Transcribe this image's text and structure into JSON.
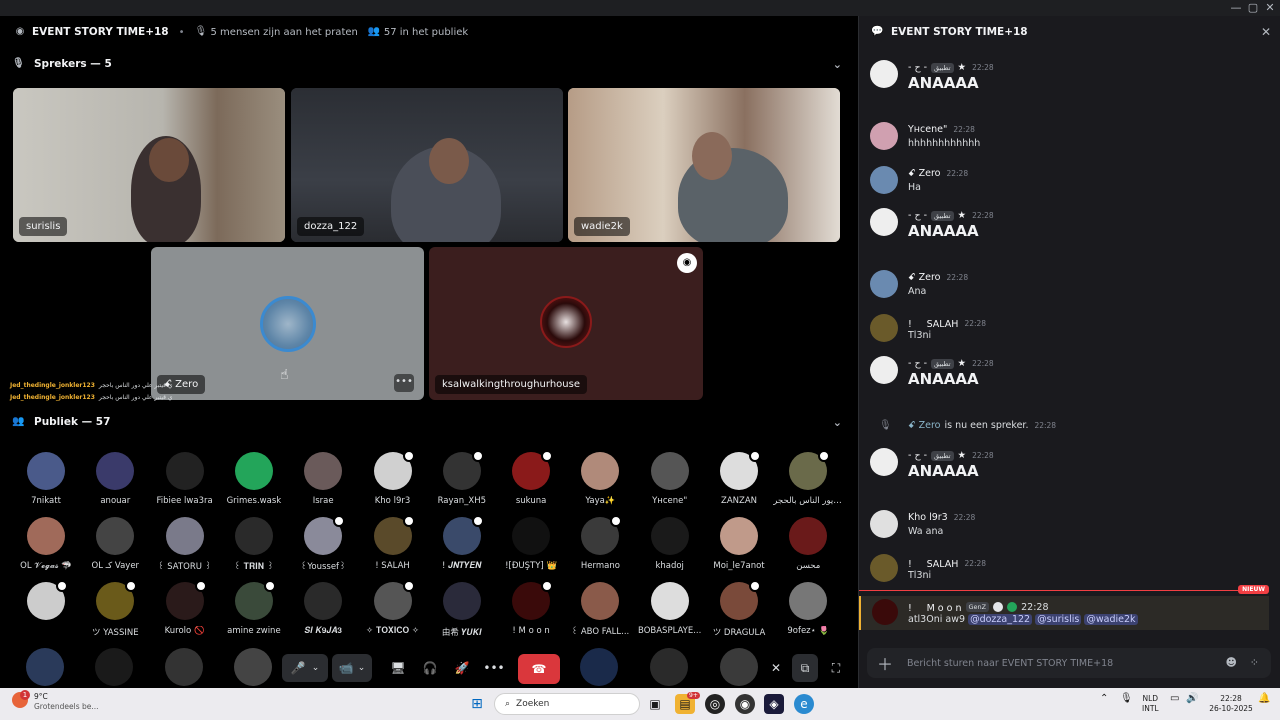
{
  "window": {
    "minimize": "—",
    "maximize": "▢",
    "close": "✕"
  },
  "stage": {
    "title": "EVENT STORY TIME+18",
    "speaking_count": "5 mensen zijn aan het praten",
    "audience_count": "57 in het publiek",
    "speakers_header": "Sprekers — 5",
    "audience_header": "Publiek — 57",
    "speakers": [
      {
        "name": "surislis"
      },
      {
        "name": "dozza_122"
      },
      {
        "name": "wadie2k"
      },
      {
        "name": "ꗃ Zero"
      },
      {
        "name": "ksalwalkingthroughurhouse"
      }
    ],
    "overlay_lines": [
      {
        "user": "Jed_thedingle_jonkler123",
        "text": "ي قيتبر علي دور الناس باحجر"
      },
      {
        "user": "Jed_thedingle_jonkler123",
        "text": "ي قيتبر علي دور الناس باحجر"
      }
    ],
    "audience": [
      {
        "name": "7nikatt",
        "color": "#4a5a8a",
        "mic": false
      },
      {
        "name": "anouar",
        "color": "#3a3a6a",
        "mic": false
      },
      {
        "name": "Fibiee lwa3ra",
        "color": "#222222",
        "mic": false
      },
      {
        "name": "Grimes.wask",
        "color": "#23a55a",
        "mic": false
      },
      {
        "name": "Israe",
        "color": "#6a5a5a",
        "mic": false
      },
      {
        "name": "Kho l9r3",
        "color": "#d0d0d0",
        "mic": true
      },
      {
        "name": "Rayan_XH5",
        "color": "#333333",
        "mic": true
      },
      {
        "name": "sukuna",
        "color": "#8a1a1a",
        "mic": true
      },
      {
        "name": "Yaya✨",
        "color": "#b08a7a",
        "mic": false
      },
      {
        "name": "Yнcene\"",
        "color": "#555555",
        "mic": false
      },
      {
        "name": "ZANZAN",
        "color": "#dddddd",
        "mic": true
      },
      {
        "name": "ديور الناس بالحجر...",
        "color": "#6a6a4a",
        "mic": true
      },
      {
        "name": "OL 𝓥𝓮𝓰𝓪𝓼 🦈",
        "color": "#a06a5a",
        "mic": false
      },
      {
        "name": "OL كـ Vayer",
        "color": "#444444",
        "mic": false
      },
      {
        "name": "꒰ SATORU ꒱",
        "color": "#7a7a8a",
        "mic": false
      },
      {
        "name": "꒰ 𝐓𝐑𝐈𝐍 ꒱",
        "color": "#2a2a2a",
        "mic": false
      },
      {
        "name": "꒰Youssef꒱",
        "color": "#8a8a9a",
        "mic": true
      },
      {
        "name": "! SALAH",
        "color": "#5a4a2a",
        "mic": true
      },
      {
        "name": "! 𝑱𝑵𝑻𝒀𝑬𝑵",
        "color": "#3a4a6a",
        "mic": true
      },
      {
        "name": "![ĐÜŞŤÝ] 👑",
        "color": "#111111",
        "mic": false
      },
      {
        "name": "Hermano",
        "color": "#3a3a3a",
        "mic": true
      },
      {
        "name": "khadoj",
        "color": "#1a1a1a",
        "mic": false
      },
      {
        "name": "Moi_le7anot",
        "color": "#c09a8a",
        "mic": false
      },
      {
        "name": "محسن",
        "color": "#6a1a1a",
        "mic": false
      },
      {
        "name": "ㅤ",
        "color": "#cccccc",
        "mic": true
      },
      {
        "name": "ツ YASSINE",
        "color": "#6a5a1a",
        "mic": true
      },
      {
        "name": "Kurolo 🚫",
        "color": "#2a1a1a",
        "mic": true
      },
      {
        "name": "amine zwine",
        "color": "#3a4a3a",
        "mic": true
      },
      {
        "name": "𝑺𝑰 𝑲𝟗𝑱𝑨𝟑",
        "color": "#2a2a2a",
        "mic": false
      },
      {
        "name": "✧ 𝐓𝐎𝐗𝐈𝐂𝐎 ✧",
        "color": "#555555",
        "mic": true
      },
      {
        "name": "由希 𝒀𝑼𝑲𝑰",
        "color": "#2a2a3a",
        "mic": false
      },
      {
        "name": "! M o o n",
        "color": "#3a0a0a",
        "mic": true
      },
      {
        "name": "꒰ ABO FALL...",
        "color": "#8a5a4a",
        "mic": false
      },
      {
        "name": "BOBASPLAYE...",
        "color": "#dddddd",
        "mic": false
      },
      {
        "name": "ツ DRAGULA",
        "color": "#7a4a3a",
        "mic": true
      },
      {
        "name": "9ofez⋆ 🌷",
        "color": "#777777",
        "mic": false
      }
    ],
    "controls": {
      "mic": "🎤",
      "camera": "📹",
      "share": "🖥",
      "sound": "🎧",
      "activity": "🚀",
      "more": "•••",
      "leave": "☎",
      "fullscreen": "⛶"
    }
  },
  "chat": {
    "title": "EVENT STORY TIME+18",
    "messages": [
      {
        "author": "- ح -",
        "tag": "تطبيق",
        "time": "22:28",
        "text": "ANAAAA",
        "big": true,
        "color": "#eeeeee"
      },
      {
        "author": "Yнcene\"",
        "tag": "",
        "time": "22:28",
        "text": "hhhhhhhhhhhh",
        "big": false,
        "color": "#d0a0b0"
      },
      {
        "author": "ꗃ Zero",
        "tag": "",
        "time": "22:28",
        "text": "Ha",
        "big": false,
        "color": "#6a8ab0"
      },
      {
        "author": "- ح -",
        "tag": "تطبيق",
        "time": "22:28",
        "text": "ANAAAA",
        "big": true,
        "color": "#eeeeee"
      },
      {
        "author": "ꗃ Zero",
        "tag": "",
        "time": "22:28",
        "text": "Ana",
        "big": false,
        "color": "#6a8ab0"
      },
      {
        "author": "! ㅤ SALAH",
        "tag": "",
        "time": "22:28",
        "text": "Tl3ni",
        "big": false,
        "color": "#6a5a2a"
      },
      {
        "author": "- ح -",
        "tag": "تطبيق",
        "time": "22:28",
        "text": "ANAAAA",
        "big": true,
        "color": "#eeeeee"
      },
      {
        "author": "- ح -",
        "tag": "تطبيق",
        "time": "22:28",
        "text": "ANAAAA",
        "big": true,
        "color": "#eeeeee"
      },
      {
        "author": "Kho l9r3",
        "tag": "",
        "time": "22:28",
        "text": "Wa ana",
        "big": false,
        "color": "#e0e0e0"
      },
      {
        "author": "! ㅤ SALAH",
        "tag": "",
        "time": "22:28",
        "text": "Tl3ni",
        "big": false,
        "color": "#6a5a2a"
      }
    ],
    "system": {
      "user": "ꗃ Zero",
      "text": "is nu een spreker.",
      "time": "22:28"
    },
    "new_label": "NIEUW",
    "last": {
      "author": "! ㅤ M o o n",
      "tag": "GenZ",
      "time": "22:28",
      "text": "atl3Oni aw9",
      "mentions": [
        "@dozza_122",
        "@surislis",
        "@wadie2k"
      ]
    },
    "input_placeholder": "Bericht sturen naar EVENT STORY TIME+18"
  },
  "taskbar": {
    "temp": "9°C",
    "weather": "Grotendeels be...",
    "search": "Zoeken",
    "lang1": "NLD",
    "lang2": "INTL",
    "time": "22:28",
    "date": "26-10-2025",
    "notif_count": "1",
    "discord_badge": "9+"
  }
}
